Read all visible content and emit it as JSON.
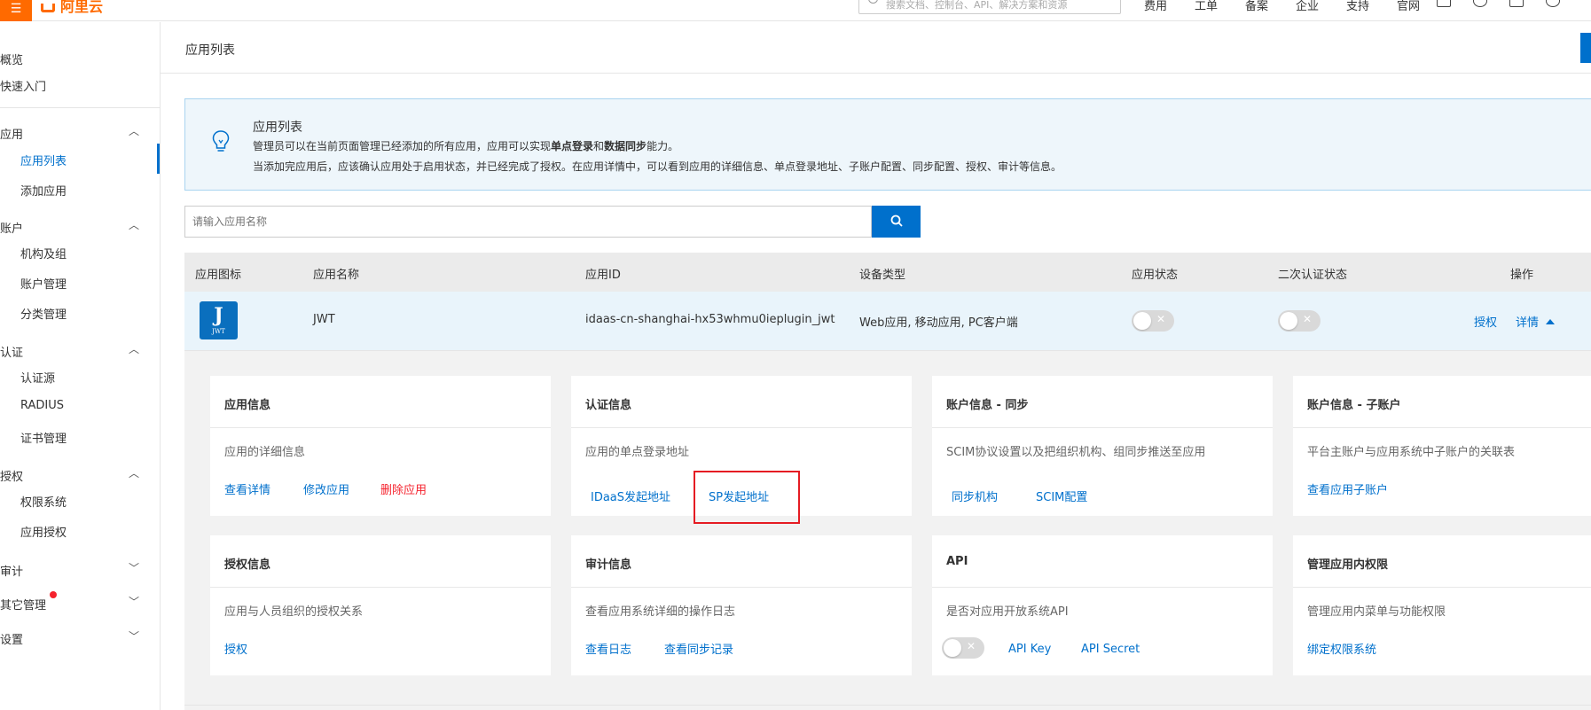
{
  "topbar": {
    "logo_text": "阿里云",
    "search_placeholder": "搜索文档、控制台、API、解决方案和资源",
    "nav": [
      "费用",
      "工单",
      "备案",
      "企业",
      "支持",
      "官网"
    ]
  },
  "sidebar": {
    "items": [
      {
        "label": "概览"
      },
      {
        "label": "快速入门"
      },
      {
        "label": "应用",
        "children": [
          "应用列表",
          "添加应用"
        ]
      },
      {
        "label": "账户",
        "children": [
          "机构及组",
          "账户管理",
          "分类管理"
        ]
      },
      {
        "label": "认证",
        "children": [
          "认证源",
          "RADIUS",
          "证书管理"
        ]
      },
      {
        "label": "授权",
        "children": [
          "权限系统",
          "应用授权"
        ]
      },
      {
        "label": "审计"
      },
      {
        "label": "其它管理"
      },
      {
        "label": "设置"
      }
    ],
    "active": "应用列表"
  },
  "header": {
    "title": "应用列表"
  },
  "info": {
    "title": "应用列表",
    "line1_prefix": "管理员可以在当前页面管理已经添加的所有应用，应用可以实现",
    "line1_bold1": "单点登录",
    "line1_mid": "和",
    "line1_bold2": "数据同步",
    "line1_suffix": "能力。",
    "line2": "当添加完应用后，应该确认应用处于启用状态，并已经完成了授权。在应用详情中，可以看到应用的详细信息、单点登录地址、子账户配置、同步配置、授权、审计等信息。"
  },
  "search": {
    "placeholder": "请输入应用名称"
  },
  "table": {
    "columns": [
      "应用图标",
      "应用名称",
      "应用ID",
      "设备类型",
      "应用状态",
      "二次认证状态",
      "操作"
    ],
    "row": {
      "icon_letter": "J",
      "icon_sub": "JWT",
      "name": "JWT",
      "app_id": "idaas-cn-shanghai-hx53whmu0ieplugin_jwt",
      "device": "Web应用, 移动应用, PC客户端",
      "status": false,
      "mfa_status": false,
      "actions": [
        "授权",
        "详情"
      ]
    }
  },
  "cards": [
    {
      "title": "应用信息",
      "desc": "应用的详细信息",
      "links": [
        "查看详情",
        "修改应用",
        "删除应用"
      ]
    },
    {
      "title": "认证信息",
      "desc": "应用的单点登录地址",
      "links": [
        "IDaaS发起地址",
        "SP发起地址"
      ]
    },
    {
      "title": "账户信息 - 同步",
      "desc": "SCIM协议设置以及把组织机构、组同步推送至应用",
      "links": [
        "同步机构",
        "SCIM配置"
      ]
    },
    {
      "title": "账户信息 - 子账户",
      "desc": "平台主账户与应用系统中子账户的关联表",
      "links": [
        "查看应用子账户"
      ]
    },
    {
      "title": "授权信息",
      "desc": "应用与人员组织的授权关系",
      "links": [
        "授权"
      ]
    },
    {
      "title": "审计信息",
      "desc": "查看应用系统详细的操作日志",
      "links": [
        "查看日志",
        "查看同步记录"
      ]
    },
    {
      "title": "API",
      "desc": "是否对应用开放系统API",
      "links": [
        "API Key",
        "API Secret"
      ],
      "toggle": false
    },
    {
      "title": "管理应用内权限",
      "desc": "管理应用内菜单与功能权限",
      "links": [
        "绑定权限系统"
      ]
    }
  ],
  "colors": {
    "accent": "#0070cc",
    "brand": "#ff6a00",
    "danger": "#f5222d",
    "highlight": "#e51c23"
  }
}
